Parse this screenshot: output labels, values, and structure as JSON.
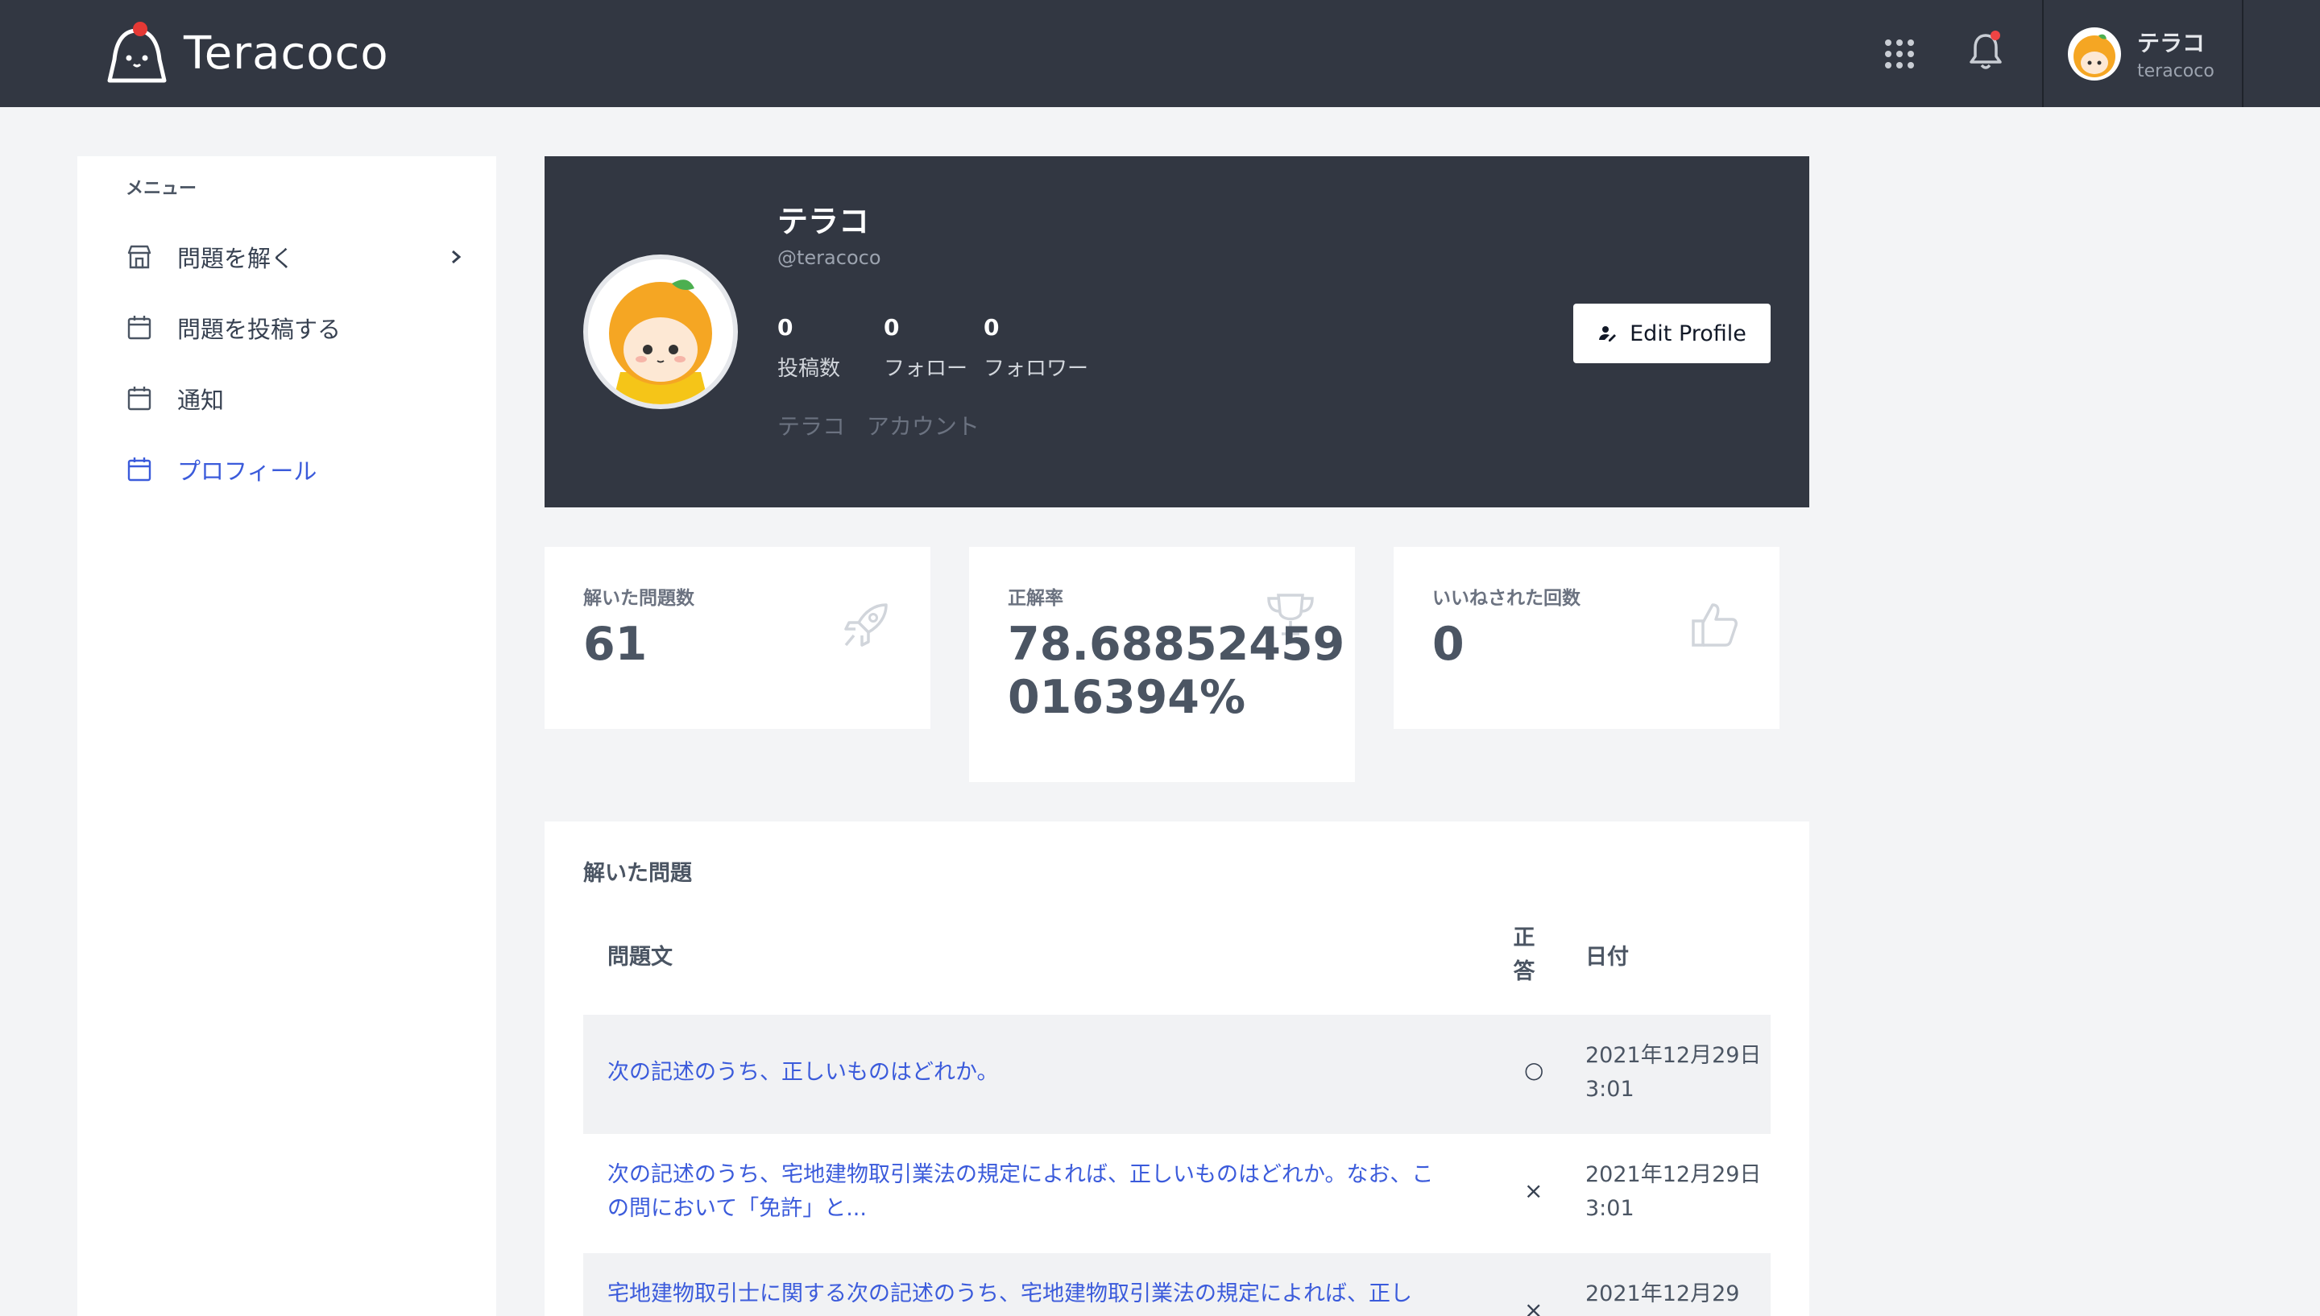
{
  "header": {
    "brand": "Teracoco",
    "apps_icon": "grid-icon",
    "bell_icon": "bell-icon",
    "notification_dot_color": "#ef4444",
    "user": {
      "name": "テラコ",
      "handle": "teracoco"
    }
  },
  "sidebar": {
    "caption": "メニュー",
    "items": [
      {
        "label": "問題を解く",
        "icon": "store-icon",
        "has_chevron": true,
        "active": false
      },
      {
        "label": "問題を投稿する",
        "icon": "calendar-icon",
        "active": false
      },
      {
        "label": "通知",
        "icon": "calendar-icon",
        "active": false
      },
      {
        "label": "プロフィール",
        "icon": "calendar-icon",
        "active": true
      }
    ]
  },
  "profile": {
    "name": "テラコ",
    "handle": "@teracoco",
    "stats": [
      {
        "value": "0",
        "label": "投稿数"
      },
      {
        "value": "0",
        "label": "フォロー"
      },
      {
        "value": "0",
        "label": "フォロワー"
      }
    ],
    "tags": "テラコ アカウント",
    "edit_button": "Edit Profile"
  },
  "cards": [
    {
      "label": "解いた問題数",
      "value": "61",
      "icon": "rocket-icon"
    },
    {
      "label": "正解率",
      "value": "78.68852459016394%",
      "icon": "trophy-icon"
    },
    {
      "label": "いいねされた回数",
      "value": "0",
      "icon": "thumbs-up-icon"
    }
  ],
  "solved": {
    "title": "解いた問題",
    "columns": {
      "question": "問題文",
      "correct": "正答",
      "date": "日付"
    },
    "rows": [
      {
        "question": "次の記述のうち、正しいものはどれか。",
        "result": "○",
        "date": "2021年12月29日3:01"
      },
      {
        "question": "次の記述のうち、宅地建物取引業法の規定によれば、正しいものはどれか。なお、この問において「免許」と...",
        "result": "×",
        "date": "2021年12月29日3:01"
      },
      {
        "question": "宅地建物取引士に関する次の記述のうち、宅地建物取引業法の規定によれば、正し",
        "result": "×",
        "date": "2021年12月29"
      }
    ]
  },
  "colors": {
    "header_bg": "#323742",
    "accent": "#3b5bdb",
    "page_bg": "#f3f4f6"
  }
}
